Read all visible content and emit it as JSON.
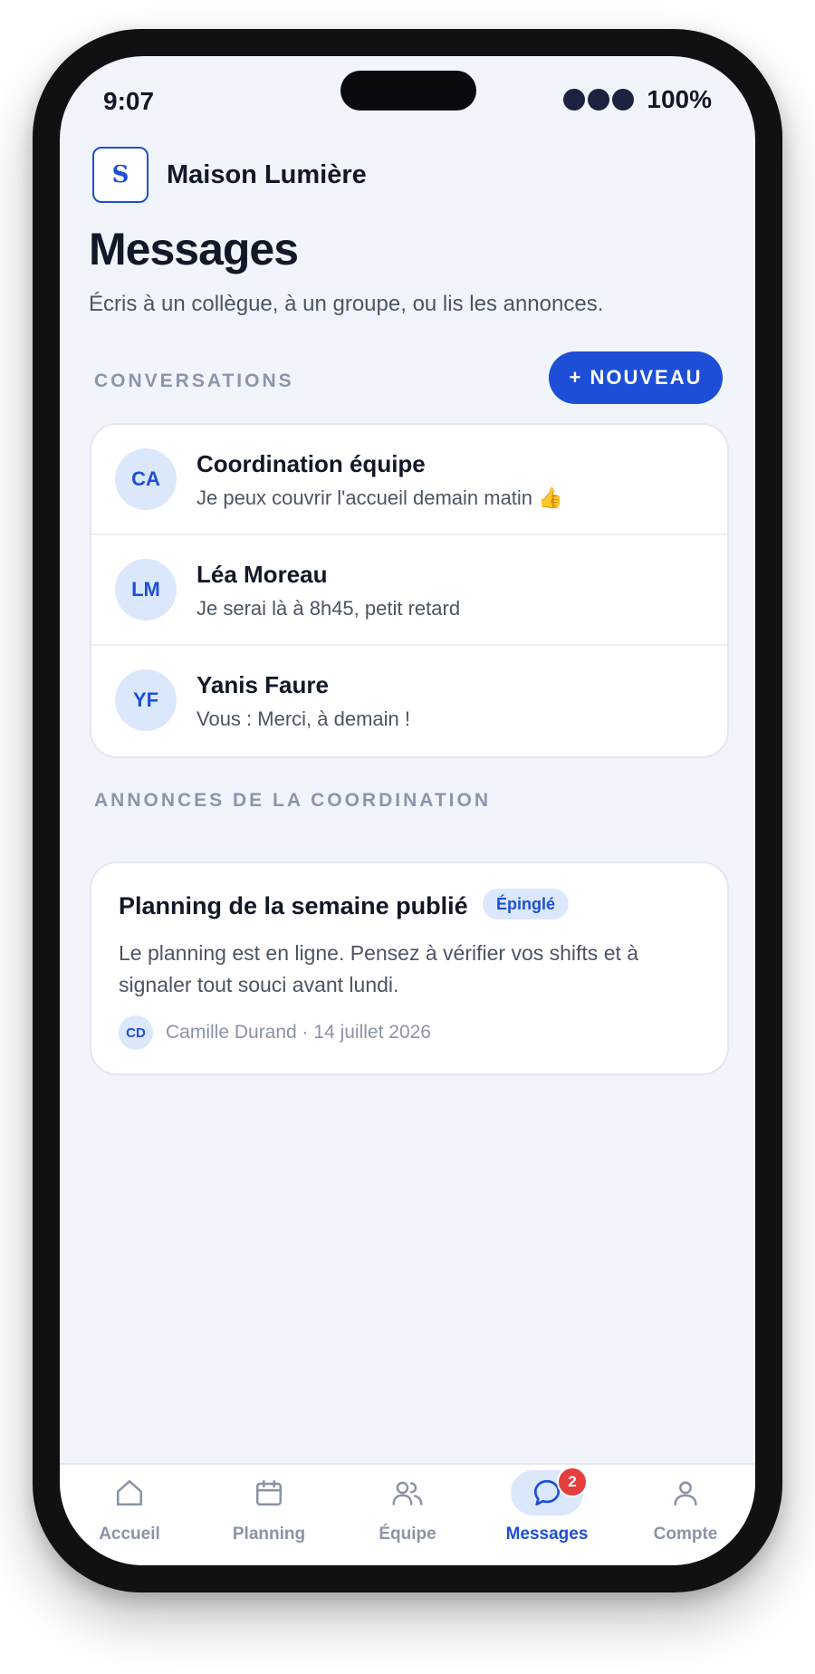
{
  "status_bar": {
    "time": "9:07",
    "battery": "100%"
  },
  "brand": {
    "logo_letter": "S",
    "name": "Maison Lumière"
  },
  "header": {
    "title": "Messages",
    "subtitle": "Écris à un collègue, à un groupe, ou lis les annonces."
  },
  "conversations": {
    "section_label": "CONVERSATIONS",
    "new_button_label": "+ NOUVEAU",
    "items": [
      {
        "initials": "CA",
        "name": "Coordination équipe",
        "preview": "Je peux couvrir l'accueil demain matin 👍"
      },
      {
        "initials": "LM",
        "name": "Léa Moreau",
        "preview": "Je serai là à 8h45, petit retard"
      },
      {
        "initials": "YF",
        "name": "Yanis Faure",
        "preview": "Vous : Merci, à demain !"
      }
    ]
  },
  "announcements": {
    "section_label": "ANNONCES DE LA COORDINATION",
    "items": [
      {
        "title": "Planning de la semaine publié",
        "badge": "Épinglé",
        "body": "Le planning est en ligne. Pensez à vérifier vos shifts et à signaler tout souci avant lundi.",
        "author_initials": "CD",
        "author_line": "Camille Durand · 14 juillet 2026"
      }
    ]
  },
  "tab_bar": {
    "tabs": [
      {
        "label": "Accueil",
        "icon": "home-icon"
      },
      {
        "label": "Planning",
        "icon": "calendar-icon"
      },
      {
        "label": "Équipe",
        "icon": "team-icon"
      },
      {
        "label": "Messages",
        "icon": "chat-icon",
        "active": true,
        "badge": "2"
      },
      {
        "label": "Compte",
        "icon": "user-icon"
      }
    ]
  },
  "colors": {
    "accent": "#1d4ed8",
    "background": "#f1f4fb",
    "badge_red": "#e53e3e",
    "avatar_bg": "#dbe8fc"
  }
}
